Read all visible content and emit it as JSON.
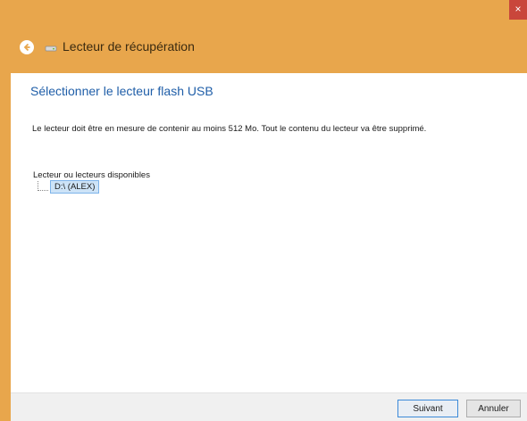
{
  "window": {
    "close_glyph": "×",
    "header_title": "Lecteur de récupération",
    "accent_color": "#e8a64c"
  },
  "main": {
    "section_title": "Sélectionner le lecteur flash USB",
    "description": "Le lecteur doit être en mesure de contenir au moins 512 Mo. Tout le contenu du lecteur va être supprimé.",
    "drives_label": "Lecteur ou lecteurs disponibles",
    "drives": [
      {
        "label": "D:\\ (ALEX)",
        "selected": true
      }
    ]
  },
  "footer": {
    "next_label": "Suivant",
    "cancel_label": "Annuler"
  },
  "icons": {
    "back": "back-arrow-icon",
    "drive": "usb-drive-icon",
    "close": "close-icon"
  }
}
